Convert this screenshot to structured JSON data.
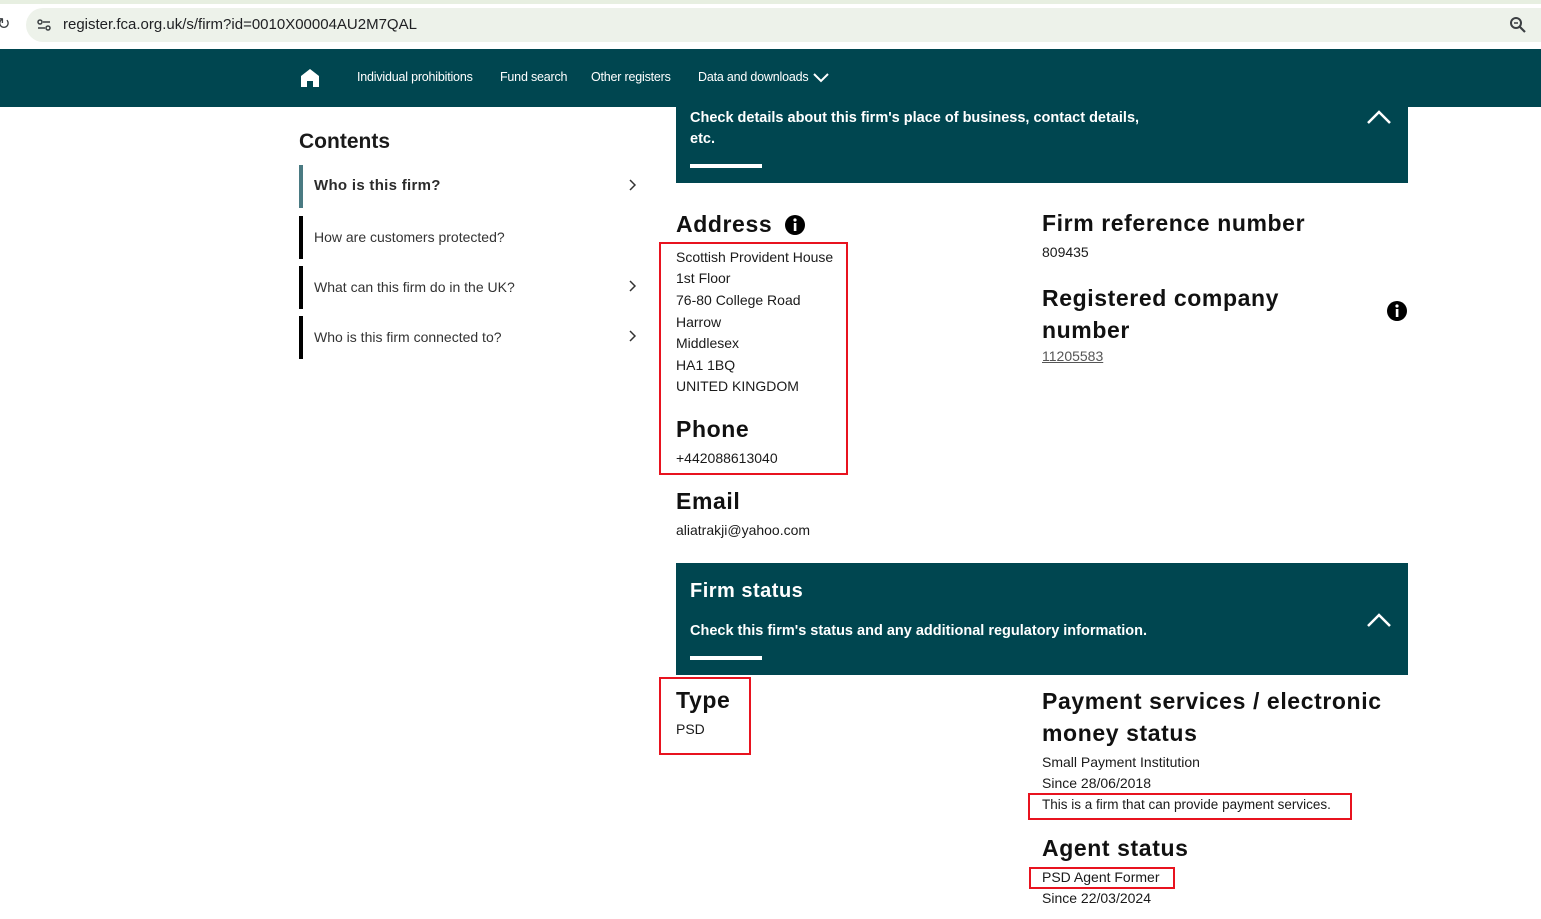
{
  "browser": {
    "url": "register.fca.org.uk/s/firm?id=0010X00004AU2M7QAL"
  },
  "nav": {
    "items": [
      {
        "label": "Individual prohibitions"
      },
      {
        "label": "Fund search"
      },
      {
        "label": "Other registers"
      },
      {
        "label": "Data and downloads"
      }
    ]
  },
  "contents": {
    "title": "Contents",
    "items": [
      {
        "label": "Who is this firm?"
      },
      {
        "label": "How are customers protected?"
      },
      {
        "label": "What can this firm do in the UK?"
      },
      {
        "label": "Who is this firm connected to?"
      }
    ]
  },
  "contact_panel": {
    "description_line1": "Check details about this firm's place of business, contact details,",
    "description_line2": "etc."
  },
  "address": {
    "heading": "Address",
    "lines": [
      "Scottish Provident House",
      "1st Floor",
      "76-80 College Road",
      "Harrow",
      "Middlesex",
      "HA1 1BQ",
      "UNITED KINGDOM"
    ]
  },
  "phone": {
    "heading": "Phone",
    "value": "+442088613040"
  },
  "email": {
    "heading": "Email",
    "value": "aliatrakji@yahoo.com"
  },
  "frn": {
    "heading": "Firm reference number",
    "value": "809435"
  },
  "company_number": {
    "heading_line1": "Registered company",
    "heading_line2": "number",
    "value": "11205583"
  },
  "status_panel": {
    "title": "Firm status",
    "description": "Check this firm's status and any additional regulatory information."
  },
  "type": {
    "heading": "Type",
    "value": "PSD"
  },
  "payment_status": {
    "heading_line1": "Payment services / electronic",
    "heading_line2": "money status",
    "value": "Small Payment Institution",
    "since": "Since 28/06/2018",
    "note": "This is a firm that can provide payment services."
  },
  "agent_status": {
    "heading": "Agent status",
    "value": "PSD Agent Former",
    "since": "Since 22/03/2024"
  },
  "colors": {
    "brand": "#004650",
    "annotation": "#e8131f"
  }
}
